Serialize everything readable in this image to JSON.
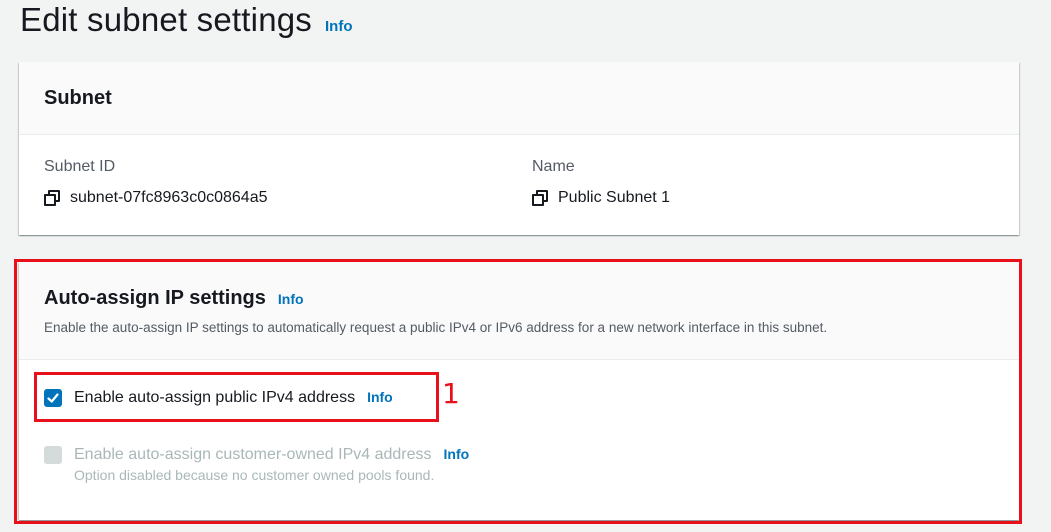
{
  "page": {
    "title": "Edit subnet settings",
    "info_label": "Info"
  },
  "subnet_panel": {
    "heading": "Subnet",
    "fields": [
      {
        "label": "Subnet ID",
        "value": "subnet-07fc8963c0c0864a5",
        "icon": "copy-icon"
      },
      {
        "label": "Name",
        "value": "Public Subnet 1",
        "icon": "copy-icon"
      }
    ]
  },
  "auto_assign_panel": {
    "heading": "Auto-assign IP settings",
    "info_label": "Info",
    "description": "Enable the auto-assign IP settings to automatically request a public IPv4 or IPv6 address for a new network interface in this subnet.",
    "options": [
      {
        "label": "Enable auto-assign public IPv4 address",
        "info_label": "Info",
        "checked": true,
        "disabled": false
      },
      {
        "label": "Enable auto-assign customer-owned IPv4 address",
        "info_label": "Info",
        "checked": false,
        "disabled": true,
        "hint": "Option disabled because no customer owned pools found."
      }
    ]
  },
  "annotations": {
    "step_number": "1",
    "color": "#e8101a"
  },
  "colors": {
    "link": "#0073bb",
    "checkbox_checked": "#0073bb",
    "background": "#f2f3f3"
  }
}
